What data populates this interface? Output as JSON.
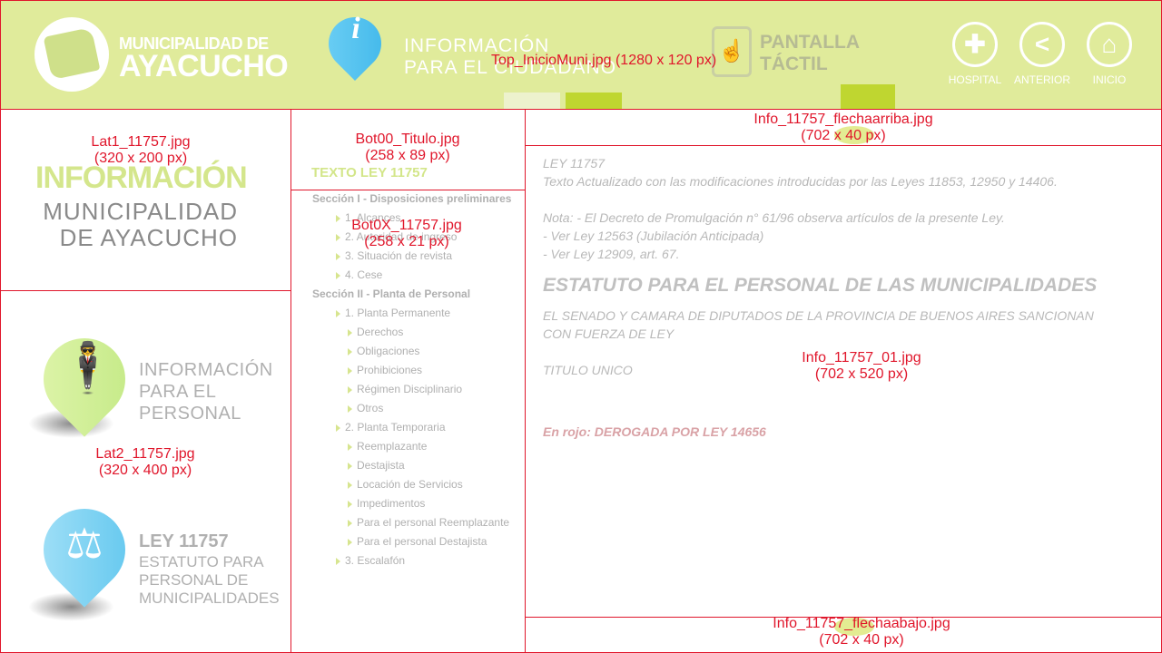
{
  "header": {
    "brand_line1": "MUNICIPALIDAD DE",
    "brand_line2": "AYACUCHO",
    "info_icon": "i",
    "info_line1": "INFORMACIÓN",
    "info_line2": "PARA EL CIUDADANO",
    "touch_line1": "PANTALLA",
    "touch_line2": "TÁCTIL",
    "nav": [
      {
        "label": "HOSPITAL",
        "icon": "plus-icon"
      },
      {
        "label": "ANTERIOR",
        "icon": "chevron-left-icon"
      },
      {
        "label": "INICIO",
        "icon": "home-icon"
      }
    ],
    "annotation": "Top_InicioMuni.jpg (1280 x 120 px)"
  },
  "lat1": {
    "title": "INFORMACIÓN",
    "sub_line1": "MUNICIPALIDAD",
    "sub_line2": "DE AYACUCHO",
    "annotation_line1": "Lat1_11757.jpg",
    "annotation_line2": "(320 x 200 px)"
  },
  "lat2": {
    "personal_line1": "INFORMACIÓN",
    "personal_line2": "PARA EL",
    "personal_line3": "PERSONAL",
    "ley_title": "LEY 11757",
    "ley_line1": "ESTATUTO PARA",
    "ley_line2": "PERSONAL DE",
    "ley_line3": "MUNICIPALIDADES",
    "annotation_line1": "Lat2_11757.jpg",
    "annotation_line2": "(320 x 400 px)"
  },
  "menu": {
    "title": "TEXTO LEY 11757",
    "title_annotation_line1": "Bot00_Titulo.jpg",
    "title_annotation_line2": "(258 x 89 px)",
    "item_annotation_line1": "Bot0X_11757.jpg",
    "item_annotation_line2": "(258 x 21 px)",
    "items": [
      {
        "label": "Sección I - Disposiciones preliminares",
        "level": 0
      },
      {
        "label": "1. Alcances",
        "level": 1
      },
      {
        "label": "2. Autoridad de ingreso",
        "level": 1
      },
      {
        "label": "3. Situación de revista",
        "level": 1
      },
      {
        "label": "4. Cese",
        "level": 1
      },
      {
        "label": "Sección II - Planta de Personal",
        "level": 0
      },
      {
        "label": "1. Planta Permanente",
        "level": 1
      },
      {
        "label": "Derechos",
        "level": 2
      },
      {
        "label": "Obligaciones",
        "level": 2
      },
      {
        "label": "Prohibiciones",
        "level": 2
      },
      {
        "label": "Régimen Disciplinario",
        "level": 2
      },
      {
        "label": "Otros",
        "level": 2
      },
      {
        "label": "2. Planta Temporaria",
        "level": 1
      },
      {
        "label": "Reemplazante",
        "level": 2
      },
      {
        "label": "Destajista",
        "level": 2
      },
      {
        "label": "Locación de Servicios",
        "level": 2
      },
      {
        "label": "Impedimentos",
        "level": 2
      },
      {
        "label": "Para el personal Reemplazante",
        "level": 2
      },
      {
        "label": "Para el personal Destajista",
        "level": 2
      },
      {
        "label": "3. Escalafón",
        "level": 1
      }
    ]
  },
  "content": {
    "arrow_up_annotation_line1": "Info_11757_flechaarriba.jpg",
    "arrow_up_annotation_line2": "(702 x 40 px)",
    "arrow_down_annotation_line1": "Info_11757_flechaabajo.jpg",
    "arrow_down_annotation_line2": "(702 x 40 px)",
    "body_annotation_line1": "Info_11757_01.jpg",
    "body_annotation_line2": "(702 x 520 px)",
    "ley": "LEY 11757",
    "texto": "Texto Actualizado con las modificaciones introducidas por las Leyes 11853, 12950 y 14406.",
    "nota1": "Nota: - El Decreto de Promulgación  n° 61/96 observa artículos de la presente Ley.",
    "nota2": "- Ver Ley 12563 (Jubilación Anticipada)",
    "nota3": "- Ver Ley 12909, art. 67.",
    "heading": "ESTATUTO PARA EL PERSONAL DE LAS MUNICIPALIDADES",
    "senado": "EL SENADO Y CAMARA DE DIPUTADOS DE LA PROVINCIA DE BUENOS AIRES  SANCIONAN CON FUERZA DE LEY",
    "titulo": "TITULO UNICO",
    "rojo": "En rojo: DEROGADA POR LEY 14656"
  }
}
